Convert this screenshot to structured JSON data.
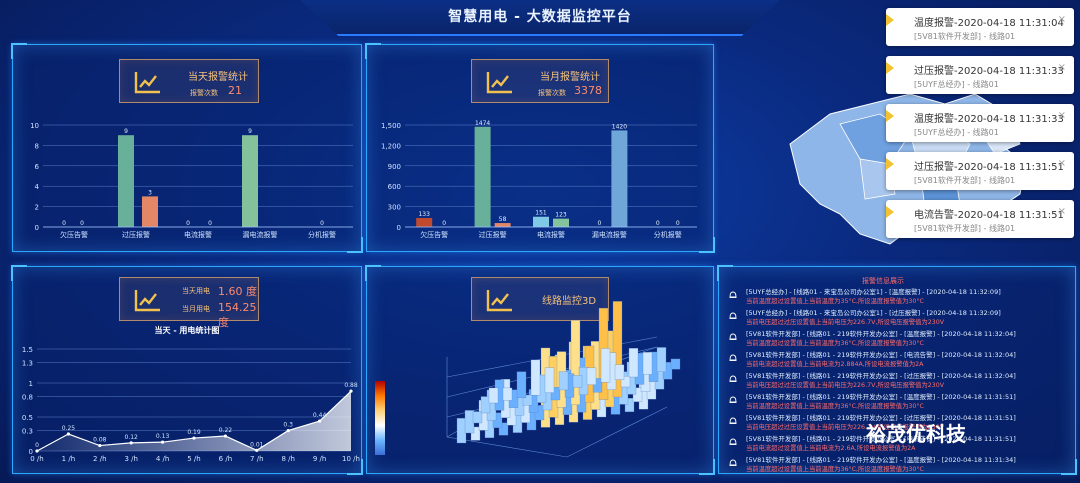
{
  "header": {
    "title": "智慧用电 - 大数据监控平台"
  },
  "cards": {
    "today": {
      "title": "当天报警统计",
      "subtitle": "报警次数",
      "value": "21"
    },
    "month": {
      "title": "当月报警统计",
      "subtitle": "报警次数",
      "value": "3378"
    },
    "power": {
      "today_label": "当天用电",
      "today_value": "1.60 度",
      "month_label": "当月用电",
      "month_value": "154.25 度"
    },
    "load3d": {
      "title": "线路监控3D"
    }
  },
  "chart_data": [
    {
      "type": "bar",
      "categories": [
        "欠压告警",
        "过压报警",
        "电流报警",
        "漏电流报警",
        "分机报警"
      ],
      "values": [
        0,
        9,
        3,
        0,
        9
      ],
      "ylim": [
        0,
        10
      ],
      "yticks": [
        "0",
        "2",
        "4",
        "6",
        "8",
        "10"
      ],
      "colors": [
        "#c04a2d",
        "#69b09a",
        "#e38767",
        "#6fa8d8",
        "#83c29b"
      ],
      "extra_values": [
        0,
        0
      ],
      "title": ""
    },
    {
      "type": "bar",
      "categories": [
        "欠压告警",
        "过压报警",
        "电流报警",
        "漏电流报警",
        "分机报警"
      ],
      "values": [
        133,
        1474,
        58,
        151,
        123,
        0,
        1420,
        0
      ],
      "series_pairs": [
        {
          "cat": "欠压告警",
          "a": 133,
          "b": 0
        },
        {
          "cat": "过压报警",
          "a": 1474,
          "b": 58
        },
        {
          "cat": "电流报警",
          "a": 151,
          "b": 123
        },
        {
          "cat": "漏电流报警",
          "a": 0,
          "b": 1420
        },
        {
          "cat": "分机报警",
          "a": 0,
          "b": 0
        }
      ],
      "ylim": [
        0,
        1500
      ],
      "yticks": [
        "0",
        "300",
        "600",
        "900",
        "1,200",
        "1,500"
      ],
      "title": ""
    },
    {
      "type": "line",
      "title": "当天 - 用电统计图",
      "x": [
        "0 /h",
        "1 /h",
        "2 /h",
        "3 /h",
        "4 /h",
        "5 /h",
        "6 /h",
        "7 /h",
        "8 /h",
        "9 /h",
        "10 /h"
      ],
      "values": [
        0,
        0.25,
        0.08,
        0.12,
        0.13,
        0.19,
        0.22,
        0.01,
        0.3,
        0.44,
        0.88
      ],
      "ylim": [
        0,
        1.5
      ],
      "yticks": [
        "0",
        "0.3",
        "0.5",
        "0.8",
        "1",
        "1.3",
        "1.5"
      ]
    }
  ],
  "notifications": [
    {
      "title": "温度报警-2020-04-18 11:31:04",
      "sub": "[5V81软件开发部] - 线路01"
    },
    {
      "title": "过压报警-2020-04-18 11:31:33",
      "sub": "[5UYF总经办] - 线路01"
    },
    {
      "title": "温度报警-2020-04-18 11:31:33",
      "sub": "[5UYF总经办] - 线路01"
    },
    {
      "title": "过压报警-2020-04-18 11:31:51",
      "sub": "[5V81软件开发部] - 线路01"
    },
    {
      "title": "电流告警-2020-04-18 11:31:51",
      "sub": "[5V81软件开发部] - 线路01"
    }
  ],
  "log": {
    "header": "报警信息展示",
    "rows": [
      {
        "main": "[5UYF总经办] - [线路01 - 来宝岛公司办公室1] - [温度报警] - [2020-04-18 11:32:09]",
        "warn": "当前温度超过设置值上当前温度为35°C,所设温度报警值为30°C"
      },
      {
        "main": "[5UYF总经办] - [线路01 - 来宝岛公司办公室1] - [过压报警] - [2020-04-18 11:32:09]",
        "warn": "当前电压超过过压设置值上当前电压为226.7V,所设电压报警值为230V"
      },
      {
        "main": "[5V81软件开发部] - [线路01 - 219软件开发办公室] - [温度报警] - [2020-04-18 11:32:04]",
        "warn": "当前温度超过设置值上当前温度为36°C,所设温度报警值为30°C"
      },
      {
        "main": "[5V81软件开发部] - [线路01 - 219软件开发办公室] - [电流告警] - [2020-04-18 11:32:04]",
        "warn": "当前电流超过设置值上当前电流为2.884A,所设电流报警值为2A"
      },
      {
        "main": "[5V81软件开发部] - [线路01 - 219软件开发办公室] - [过压报警] - [2020-04-18 11:32:04]",
        "warn": "当前电压超过过压设置值上当前电压为226.7V,所设电压报警值为230V"
      },
      {
        "main": "[5V81软件开发部] - [线路01 - 219软件开发办公室] - [温度报警] - [2020-04-18 11:31:51]",
        "warn": "当前温度超过设置值上当前温度为36°C,所设温度报警值为30°C"
      },
      {
        "main": "[5V81软件开发部] - [线路01 - 219软件开发办公室] - [过压报警] - [2020-04-18 11:31:51]",
        "warn": "当前电压超过过压设置值上当前电压为226.7V,所设电压报警值为230V"
      },
      {
        "main": "[5V81软件开发部] - [线路01 - 219软件开发办公室] - [电流告警] - [2020-04-18 11:31:51]",
        "warn": "当前电流超过设置值上当前电流为2.6A,所设电流报警值为2A"
      },
      {
        "main": "[5V81软件开发部] - [线路01 - 219软件开发办公室] - [温度报警] - [2020-04-18 11:31:34]",
        "warn": "当前温度超过设置值上当前温度为36°C,所设温度报警值为30°C"
      }
    ]
  },
  "watermark": {
    "text": "裕茂优科技"
  },
  "colors": {
    "accent": "#2aa7ff",
    "warn": "#ff6b6b",
    "gold": "#f7c27a"
  },
  "icons": {
    "bell": "bell-icon",
    "chart": "trend-chart-icon",
    "close": "close-icon",
    "warning": "warning-icon"
  }
}
